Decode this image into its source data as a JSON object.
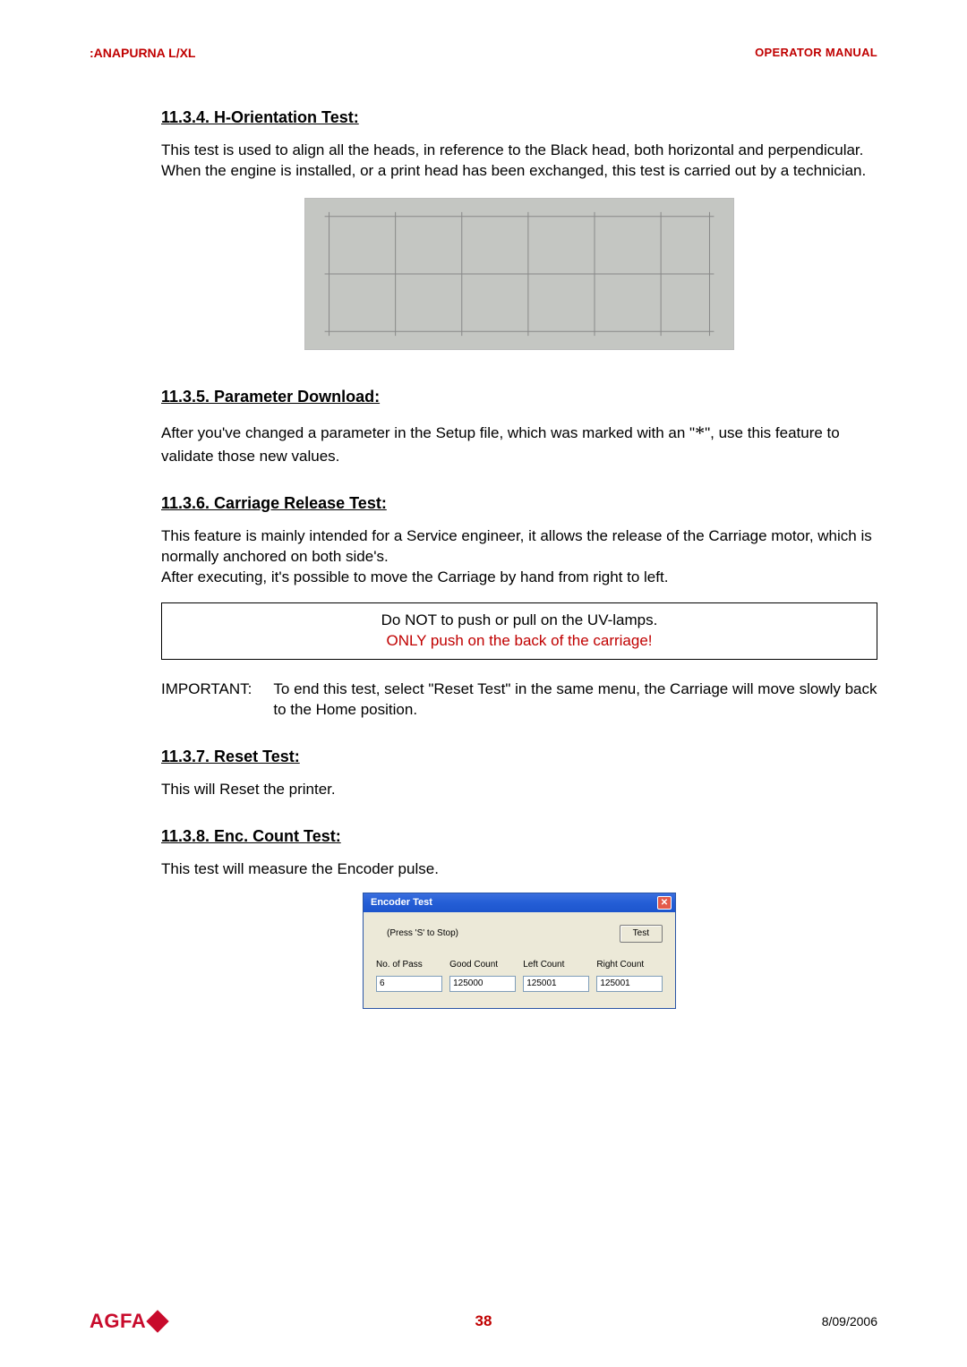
{
  "header": {
    "product": ":ANAPURNA L/XL",
    "doc_type": "OPERATOR MANUAL"
  },
  "sections": {
    "s1": {
      "heading": "11.3.4. H-Orientation Test:",
      "p1": "This test is used to align all the heads, in reference to the Black head, both horizontal and perpendicular.",
      "p2": "When the engine is installed, or a print head has been exchanged, this test is carried out by a technician."
    },
    "s2": {
      "heading": "11.3.5. Parameter Download:",
      "p1a": "After you've changed a parameter in the Setup file, which was marked with an \"",
      "p1star": "*",
      "p1b": "\", use this feature to validate those new values."
    },
    "s3": {
      "heading": "11.3.6. Carriage Release Test:",
      "p1": "This feature is mainly intended for a Service engineer, it allows the release of the Carriage motor, which is normally anchored on both side's.",
      "p2": "After executing, it's possible to move the Carriage by hand from right to left.",
      "warn1": "Do NOT to push or pull on the UV-lamps.",
      "warn2": "ONLY push on the back of the carriage!",
      "imp_label": "IMPORTANT:",
      "imp_text": "To end this test, select \"Reset Test\" in the same menu, the Carriage will move slowly back to the Home position."
    },
    "s4": {
      "heading": "11.3.7. Reset Test:",
      "p1": "This will Reset the printer."
    },
    "s5": {
      "heading": "11.3.8. Enc. Count Test:",
      "p1": "This test will measure the Encoder pulse."
    }
  },
  "encoder_dialog": {
    "title": "Encoder Test",
    "hint": "(Press 'S' to Stop)",
    "button": "Test",
    "col1": "No. of Pass",
    "col2": "Good Count",
    "col3": "Left Count",
    "col4": "Right Count",
    "v1": "6",
    "v2": "125000",
    "v3": "125001",
    "v4": "125001"
  },
  "footer": {
    "brand": "AGFA",
    "page": "38",
    "date": "8/09/2006"
  }
}
